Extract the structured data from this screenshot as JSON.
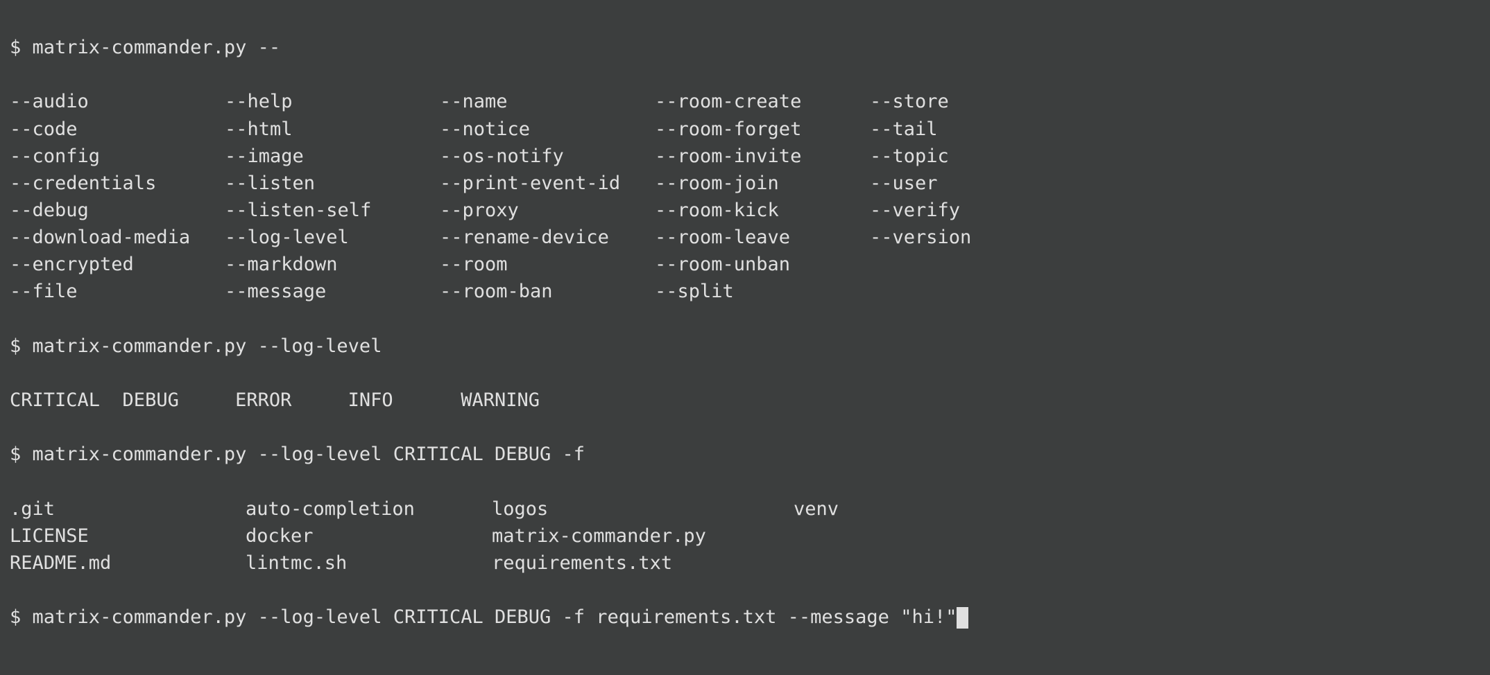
{
  "prompt": "$",
  "cmd1": "matrix-commander.py --",
  "options": [
    [
      "--audio",
      "--help",
      "--name",
      "--room-create",
      "--store"
    ],
    [
      "--code",
      "--html",
      "--notice",
      "--room-forget",
      "--tail"
    ],
    [
      "--config",
      "--image",
      "--os-notify",
      "--room-invite",
      "--topic"
    ],
    [
      "--credentials",
      "--listen",
      "--print-event-id",
      "--room-join",
      "--user"
    ],
    [
      "--debug",
      "--listen-self",
      "--proxy",
      "--room-kick",
      "--verify"
    ],
    [
      "--download-media",
      "--log-level",
      "--rename-device",
      "--room-leave",
      "--version"
    ],
    [
      "--encrypted",
      "--markdown",
      "--room",
      "--room-unban",
      ""
    ],
    [
      "--file",
      "--message",
      "--room-ban",
      "--split",
      ""
    ]
  ],
  "cmd2": "matrix-commander.py --log-level",
  "loglevels": [
    "CRITICAL",
    "DEBUG",
    "ERROR",
    "INFO",
    "WARNING"
  ],
  "loglevel_padded": "CRITICAL  DEBUG     ERROR     INFO      WARNING",
  "cmd3": "matrix-commander.py --log-level CRITICAL DEBUG -f",
  "files": [
    [
      ".git",
      "auto-completion",
      "logos",
      "venv"
    ],
    [
      "LICENSE",
      "docker",
      "matrix-commander.py",
      ""
    ],
    [
      "README.md",
      "lintmc.sh",
      "requirements.txt",
      ""
    ]
  ],
  "cmd4": "matrix-commander.py --log-level CRITICAL DEBUG -f requirements.txt --message \"hi!\""
}
